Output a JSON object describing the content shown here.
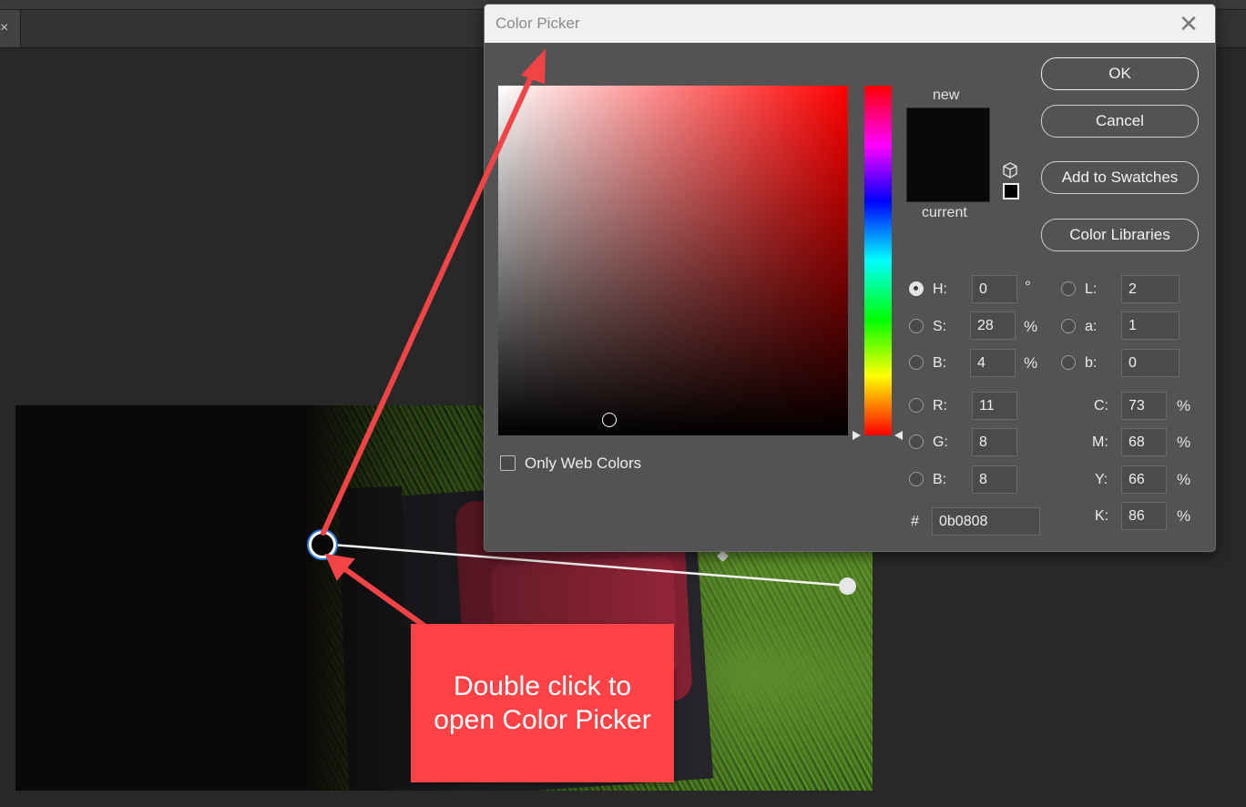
{
  "workspace": {
    "tab_close": "×"
  },
  "dialog": {
    "title": "Color Picker",
    "close_glyph": "✕",
    "new_label": "new",
    "current_label": "current",
    "only_web_colors": {
      "label": "Only Web Colors",
      "checked": false
    },
    "buttons": {
      "ok": "OK",
      "cancel": "Cancel",
      "add_to_swatches": "Add to Swatches",
      "color_libraries": "Color Libraries"
    },
    "color": {
      "new_hex_css": "#0b0808",
      "hue_field_base": "#ff0000"
    },
    "hsb": {
      "h": {
        "label": "H:",
        "value": "0",
        "unit": "°",
        "selected": true
      },
      "s": {
        "label": "S:",
        "value": "28",
        "unit": "%",
        "selected": false
      },
      "b": {
        "label": "B:",
        "value": "4",
        "unit": "%",
        "selected": false
      }
    },
    "rgb": {
      "r": {
        "label": "R:",
        "value": "11"
      },
      "g": {
        "label": "G:",
        "value": "8"
      },
      "b": {
        "label": "B:",
        "value": "8"
      }
    },
    "lab": {
      "l": {
        "label": "L:",
        "value": "2"
      },
      "a": {
        "label": "a:",
        "value": "1"
      },
      "b": {
        "label": "b:",
        "value": "0"
      }
    },
    "cmyk": {
      "c": {
        "label": "C:",
        "value": "73",
        "unit": "%"
      },
      "m": {
        "label": "M:",
        "value": "68",
        "unit": "%"
      },
      "y": {
        "label": "Y:",
        "value": "66",
        "unit": "%"
      },
      "k": {
        "label": "K:",
        "value": "86",
        "unit": "%"
      }
    },
    "hex": {
      "label": "#",
      "value": "0b0808"
    }
  },
  "annotation": {
    "callout_line1": "Double click to",
    "callout_line2": "open Color Picker",
    "arrow_color": "#f04446"
  }
}
